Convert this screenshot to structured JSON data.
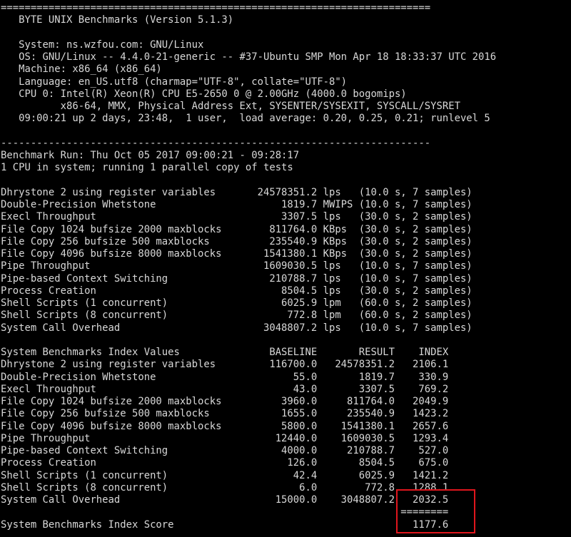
{
  "terminal": {
    "lines": [
      "========================================================================",
      "   BYTE UNIX Benchmarks (Version 5.1.3)",
      "",
      "   System: ns.wzfou.com: GNU/Linux",
      "   OS: GNU/Linux -- 4.4.0-21-generic -- #37-Ubuntu SMP Mon Apr 18 18:33:37 UTC 2016",
      "   Machine: x86_64 (x86_64)",
      "   Language: en_US.utf8 (charmap=\"UTF-8\", collate=\"UTF-8\")",
      "   CPU 0: Intel(R) Xeon(R) CPU E5-2650 0 @ 2.00GHz (4000.0 bogomips)",
      "          x86-64, MMX, Physical Address Ext, SYSENTER/SYSEXIT, SYSCALL/SYSRET",
      "   09:00:21 up 2 days, 23:48,  1 user,  load average: 0.20, 0.25, 0.21; runlevel 5",
      "",
      "------------------------------------------------------------------------",
      "Benchmark Run: Thu Oct 05 2017 09:00:21 - 09:28:17",
      "1 CPU in system; running 1 parallel copy of tests",
      "",
      "Dhrystone 2 using register variables       24578351.2 lps   (10.0 s, 7 samples)",
      "Double-Precision Whetstone                     1819.7 MWIPS (10.0 s, 7 samples)",
      "Execl Throughput                               3307.5 lps   (30.0 s, 2 samples)",
      "File Copy 1024 bufsize 2000 maxblocks        811764.0 KBps  (30.0 s, 2 samples)",
      "File Copy 256 bufsize 500 maxblocks          235540.9 KBps  (30.0 s, 2 samples)",
      "File Copy 4096 bufsize 8000 maxblocks       1541380.1 KBps  (30.0 s, 2 samples)",
      "Pipe Throughput                             1609030.5 lps   (10.0 s, 7 samples)",
      "Pipe-based Context Switching                 210788.7 lps   (10.0 s, 7 samples)",
      "Process Creation                               8504.5 lps   (30.0 s, 2 samples)",
      "Shell Scripts (1 concurrent)                   6025.9 lpm   (60.0 s, 2 samples)",
      "Shell Scripts (8 concurrent)                    772.8 lpm   (60.0 s, 2 samples)",
      "System Call Overhead                        3048807.2 lps   (10.0 s, 7 samples)",
      "",
      "System Benchmarks Index Values               BASELINE       RESULT    INDEX",
      "Dhrystone 2 using register variables         116700.0   24578351.2   2106.1",
      "Double-Precision Whetstone                       55.0       1819.7    330.9",
      "Execl Throughput                                 43.0       3307.5    769.2",
      "File Copy 1024 bufsize 2000 maxblocks          3960.0     811764.0   2049.9",
      "File Copy 256 bufsize 500 maxblocks            1655.0     235540.9   1423.2",
      "File Copy 4096 bufsize 8000 maxblocks          5800.0    1541380.1   2657.6",
      "Pipe Throughput                               12440.0    1609030.5   1293.4",
      "Pipe-based Context Switching                   4000.0     210788.7    527.0",
      "Process Creation                                126.0       8504.5    675.0",
      "Shell Scripts (1 concurrent)                     42.4       6025.9   1421.2",
      "Shell Scripts (8 concurrent)                      6.0        772.8   1288.1",
      "System Call Overhead                          15000.0    3048807.2   2032.5",
      "                                                                   ========",
      "System Benchmarks Index Score                                        1177.6"
    ]
  }
}
